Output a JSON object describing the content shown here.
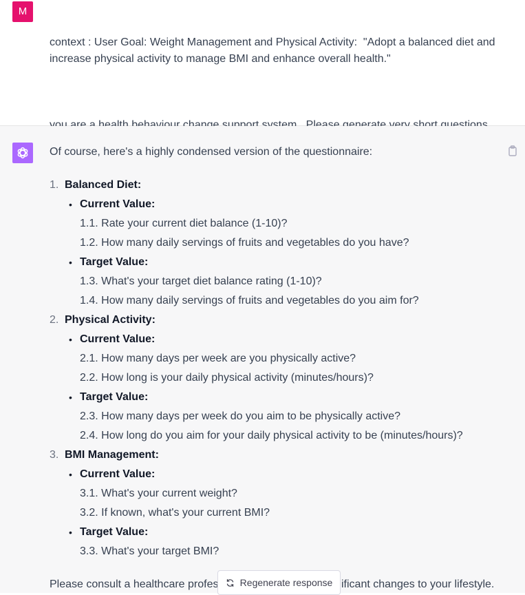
{
  "user": {
    "avatar_letter": "M",
    "paragraph1": "context : User Goal: Weight Management and Physical Activity:  \"Adopt a balanced diet and increase physical activity to manage BMI and enhance overall health.\"",
    "paragraph2": "you are a health behaviour change support system.  Please generate very short questions that asks user current value and target value for top three measures of user goal (defined in context)?"
  },
  "assistant": {
    "intro": "Of course, here's a highly condensed version of the questionnaire:",
    "sections": [
      {
        "number": "1.",
        "title": "Balanced Diet:",
        "current_label": "Current Value:",
        "current_items": [
          "1.1. Rate your current diet balance (1-10)?",
          "1.2. How many daily servings of fruits and vegetables do you have?"
        ],
        "target_label": "Target Value:",
        "target_items": [
          "1.3. What's your target diet balance rating (1-10)?",
          "1.4. How many daily servings of fruits and vegetables do you aim for?"
        ]
      },
      {
        "number": "2.",
        "title": "Physical Activity:",
        "current_label": "Current Value:",
        "current_items": [
          "2.1. How many days per week are you physically active?",
          "2.2. How long is your daily physical activity (minutes/hours)?"
        ],
        "target_label": "Target Value:",
        "target_items": [
          "2.3. How many days per week do you aim to be physically active?",
          "2.4. How long do you aim for your daily physical activity to be (minutes/hours)?"
        ]
      },
      {
        "number": "3.",
        "title": "BMI Management:",
        "current_label": "Current Value:",
        "current_items": [
          "3.1. What's your current weight?",
          "3.2. If known, what's your current BMI?"
        ],
        "target_label": "Target Value:",
        "target_items": [
          "3.3. What's your target BMI?"
        ]
      }
    ],
    "footer_visible_start": "Please consult a healthcare profes",
    "footer_visible_end": "ificant changes to your lifestyle."
  },
  "regenerate_label": "Regenerate response",
  "icons": {
    "assistant_avatar": "openai-logo-icon",
    "copy": "clipboard-icon",
    "regenerate": "refresh-icon"
  },
  "colors": {
    "user_avatar_bg": "#e5116d",
    "assistant_avatar_bg": "#ab68ff",
    "assistant_bg": "#f7f7f8"
  }
}
